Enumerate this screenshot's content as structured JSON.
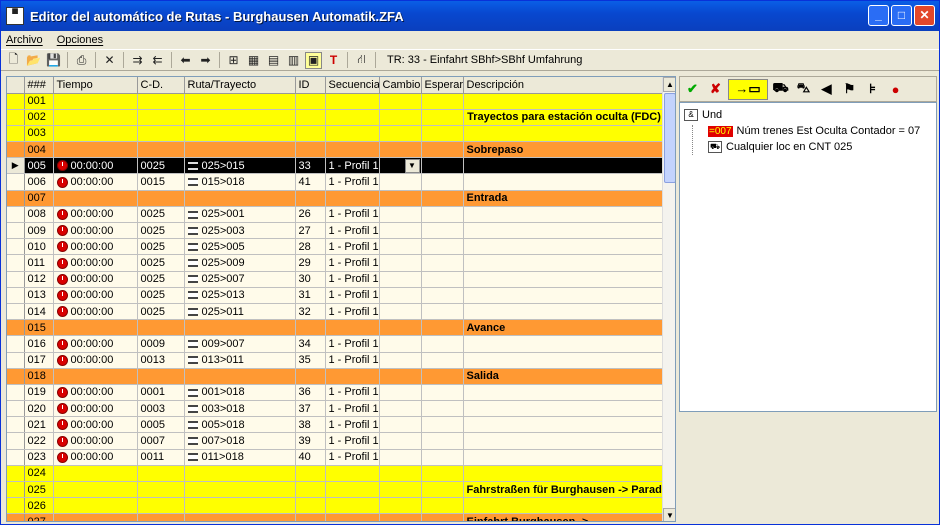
{
  "window": {
    "title": "Editor del automático de Rutas - Burghausen Automatik.ZFA",
    "icon_label": "TRAIN\nCTRL"
  },
  "menu": {
    "file": "Archivo",
    "options": "Opciones"
  },
  "toolbar": {
    "route_text": "TR: 33 - Einfahrt SBhf>SBhf Umfahrung"
  },
  "columns": [
    "###",
    "Tiempo",
    "C-D.",
    "Ruta/Trayecto",
    "ID",
    "Secuencia",
    "Cambio",
    "Esperar",
    "Descripción"
  ],
  "rows": [
    {
      "num": "001",
      "type": "yellow"
    },
    {
      "num": "002",
      "type": "yellow",
      "desc": "Trayectos para estación oculta (FDC)"
    },
    {
      "num": "003",
      "type": "yellow"
    },
    {
      "num": "004",
      "type": "orange",
      "desc": "Sobrepaso"
    },
    {
      "num": "005",
      "type": "current",
      "time": "00:00:00",
      "cd": "0025",
      "route": "025>015",
      "id": "33",
      "seq": "1 - Profil 1"
    },
    {
      "num": "006",
      "type": "data",
      "time": "00:00:00",
      "cd": "0015",
      "route": "015>018",
      "id": "41",
      "seq": "1 - Profil 1"
    },
    {
      "num": "007",
      "type": "orange",
      "desc": "Entrada"
    },
    {
      "num": "008",
      "type": "data",
      "time": "00:00:00",
      "cd": "0025",
      "route": "025>001",
      "id": "26",
      "seq": "1 - Profil 1"
    },
    {
      "num": "009",
      "type": "data",
      "time": "00:00:00",
      "cd": "0025",
      "route": "025>003",
      "id": "27",
      "seq": "1 - Profil 1"
    },
    {
      "num": "010",
      "type": "data",
      "time": "00:00:00",
      "cd": "0025",
      "route": "025>005",
      "id": "28",
      "seq": "1 - Profil 1"
    },
    {
      "num": "011",
      "type": "data",
      "time": "00:00:00",
      "cd": "0025",
      "route": "025>009",
      "id": "29",
      "seq": "1 - Profil 1"
    },
    {
      "num": "012",
      "type": "data",
      "time": "00:00:00",
      "cd": "0025",
      "route": "025>007",
      "id": "30",
      "seq": "1 - Profil 1"
    },
    {
      "num": "013",
      "type": "data",
      "time": "00:00:00",
      "cd": "0025",
      "route": "025>013",
      "id": "31",
      "seq": "1 - Profil 1"
    },
    {
      "num": "014",
      "type": "data",
      "time": "00:00:00",
      "cd": "0025",
      "route": "025>011",
      "id": "32",
      "seq": "1 - Profil 1"
    },
    {
      "num": "015",
      "type": "orange",
      "desc": "Avance"
    },
    {
      "num": "016",
      "type": "data",
      "time": "00:00:00",
      "cd": "0009",
      "route": "009>007",
      "id": "34",
      "seq": "1 - Profil 1"
    },
    {
      "num": "017",
      "type": "data",
      "time": "00:00:00",
      "cd": "0013",
      "route": "013>011",
      "id": "35",
      "seq": "1 - Profil 1"
    },
    {
      "num": "018",
      "type": "orange",
      "desc": "Salida"
    },
    {
      "num": "019",
      "type": "data",
      "time": "00:00:00",
      "cd": "0001",
      "route": "001>018",
      "id": "36",
      "seq": "1 - Profil 1"
    },
    {
      "num": "020",
      "type": "data",
      "time": "00:00:00",
      "cd": "0003",
      "route": "003>018",
      "id": "37",
      "seq": "1 - Profil 1"
    },
    {
      "num": "021",
      "type": "data",
      "time": "00:00:00",
      "cd": "0005",
      "route": "005>018",
      "id": "38",
      "seq": "1 - Profil 1"
    },
    {
      "num": "022",
      "type": "data",
      "time": "00:00:00",
      "cd": "0007",
      "route": "007>018",
      "id": "39",
      "seq": "1 - Profil 1"
    },
    {
      "num": "023",
      "type": "data",
      "time": "00:00:00",
      "cd": "0011",
      "route": "011>018",
      "id": "40",
      "seq": "1 - Profil 1"
    },
    {
      "num": "024",
      "type": "yellow"
    },
    {
      "num": "025",
      "type": "yellow",
      "desc": "Fahrstraßen für Burghausen -> Parade"
    },
    {
      "num": "026",
      "type": "yellow"
    },
    {
      "num": "027",
      "type": "orange",
      "desc": "Einfahrt Burghausen ->"
    }
  ],
  "tree": {
    "root": "Und",
    "counter_badge": "=007",
    "condition1": "Núm trenes Est Oculta Contador = 07",
    "condition2": "Cualquier loc en CNT 025"
  },
  "colors": {
    "yellow": "#ffff00",
    "orange": "#ff9933",
    "selected": "#000000",
    "row": "#fffbea"
  }
}
